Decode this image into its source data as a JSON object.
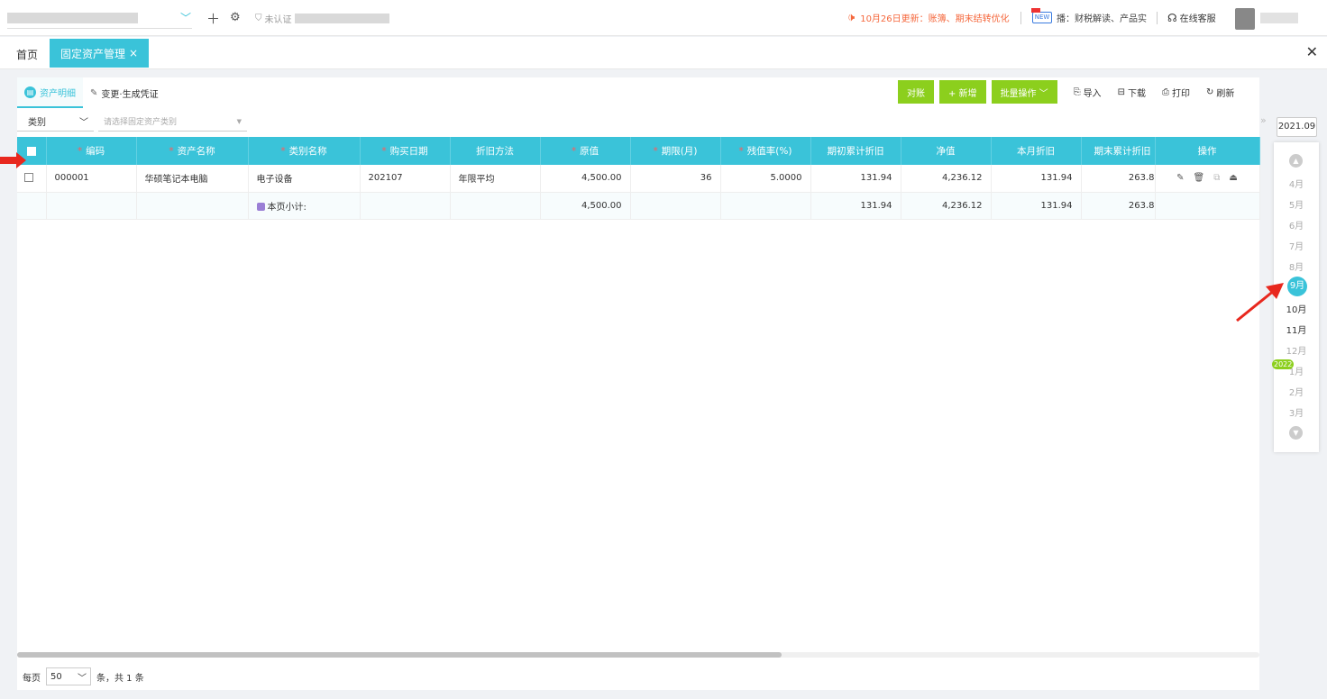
{
  "topbar": {
    "add_icon": "plus-icon",
    "settings_icon": "gear-icon",
    "auth_status": "未认证",
    "news_text": "10月26日更新：账簿、期末结转优化",
    "live_badge": "NEW",
    "live_text": "播：财税解读、产品实",
    "service_text": "在线客服"
  },
  "tabs": {
    "home": "首页",
    "active": "固定资产管理",
    "close_glyph": "×"
  },
  "subtabs": [
    {
      "label": "资产明细",
      "icon_glyph": "▤"
    },
    {
      "label": "变更·生成凭证",
      "icon_glyph": "✎"
    }
  ],
  "toolbar": {
    "reconcile": "对账",
    "add": "+ 新增",
    "batch": "批量操作",
    "import": "导入",
    "download": "下载",
    "print": "打印",
    "refresh": "刷新"
  },
  "filter": {
    "label": "类别",
    "placeholder": "请选择固定资产类别"
  },
  "table": {
    "columns": [
      {
        "label": "编码",
        "required": true
      },
      {
        "label": "资产名称",
        "required": true
      },
      {
        "label": "类别名称",
        "required": true
      },
      {
        "label": "购买日期",
        "required": true
      },
      {
        "label": "折旧方法",
        "required": false
      },
      {
        "label": "原值",
        "required": true
      },
      {
        "label": "期限(月)",
        "required": true
      },
      {
        "label": "残值率(%)",
        "required": true
      },
      {
        "label": "期初累计折旧",
        "required": false
      },
      {
        "label": "净值",
        "required": false
      },
      {
        "label": "本月折旧",
        "required": false
      },
      {
        "label": "期末累计折旧",
        "required": false
      },
      {
        "label": "操作",
        "required": false
      }
    ],
    "rows": [
      {
        "code": "000001",
        "name": "华硕笔记本电脑",
        "category": "电子设备",
        "date": "202107",
        "method": "年限平均",
        "original": "4,500.00",
        "term": "36",
        "residual": "5.0000",
        "open_dep": "131.94",
        "net": "4,236.12",
        "month_dep": "131.94",
        "end_dep": "263.8"
      }
    ],
    "subtotal": {
      "label": "本页小计:",
      "original": "4,500.00",
      "open_dep": "131.94",
      "net": "4,236.12",
      "month_dep": "131.94",
      "end_dep": "263.8"
    }
  },
  "pager": {
    "prefix": "每页",
    "size": "50",
    "suffix": "条，共 1 条"
  },
  "rail": {
    "year": "2021.09",
    "year_badge": "2022",
    "months": [
      "4月",
      "5月",
      "6月",
      "7月",
      "8月",
      "9月",
      "10月",
      "11月",
      "12月",
      "1月",
      "2月",
      "3月"
    ],
    "selected_month": "9月"
  },
  "colors": {
    "accent": "#3ac3d9",
    "green": "#8ccf1d",
    "news": "#f5683d"
  }
}
